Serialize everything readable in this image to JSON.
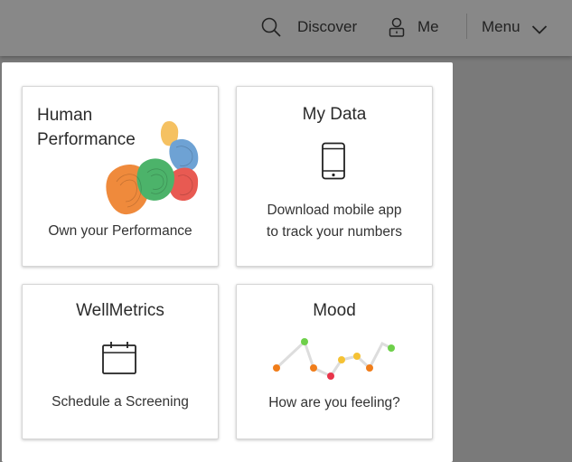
{
  "header": {
    "discover_label": "Discover",
    "me_label": "Me",
    "menu_label": "Menu",
    "icons": {
      "discover": "search-icon",
      "me": "user-lock-icon",
      "menu": "chevron-down-icon"
    }
  },
  "tiles": [
    {
      "title_line1": "Human",
      "title_line2": "Performance",
      "subtitle": "Own your Performance",
      "icon": "fingerprint-blobs-illustration"
    },
    {
      "title": "My Data",
      "subtitle_line1": "Download mobile app",
      "subtitle_line2": "to track your numbers",
      "icon": "smartphone-icon"
    },
    {
      "title": "WellMetrics",
      "subtitle": "Schedule a Screening",
      "icon": "calendar-icon"
    },
    {
      "title": "Mood",
      "subtitle": "How are you feeling?",
      "icon": "mood-line-graph"
    }
  ],
  "colors": {
    "overlay": "#7a7a7a",
    "mood_orange": "#f07d1a",
    "mood_green": "#6ed04a",
    "mood_red": "#e8344a",
    "mood_yellow": "#f5c234",
    "blob_orange": "#ef8a3c",
    "blob_green": "#4cb36a",
    "blob_red": "#e85a52",
    "blob_blue": "#6ea2d4",
    "blob_yellow": "#f5c162"
  }
}
